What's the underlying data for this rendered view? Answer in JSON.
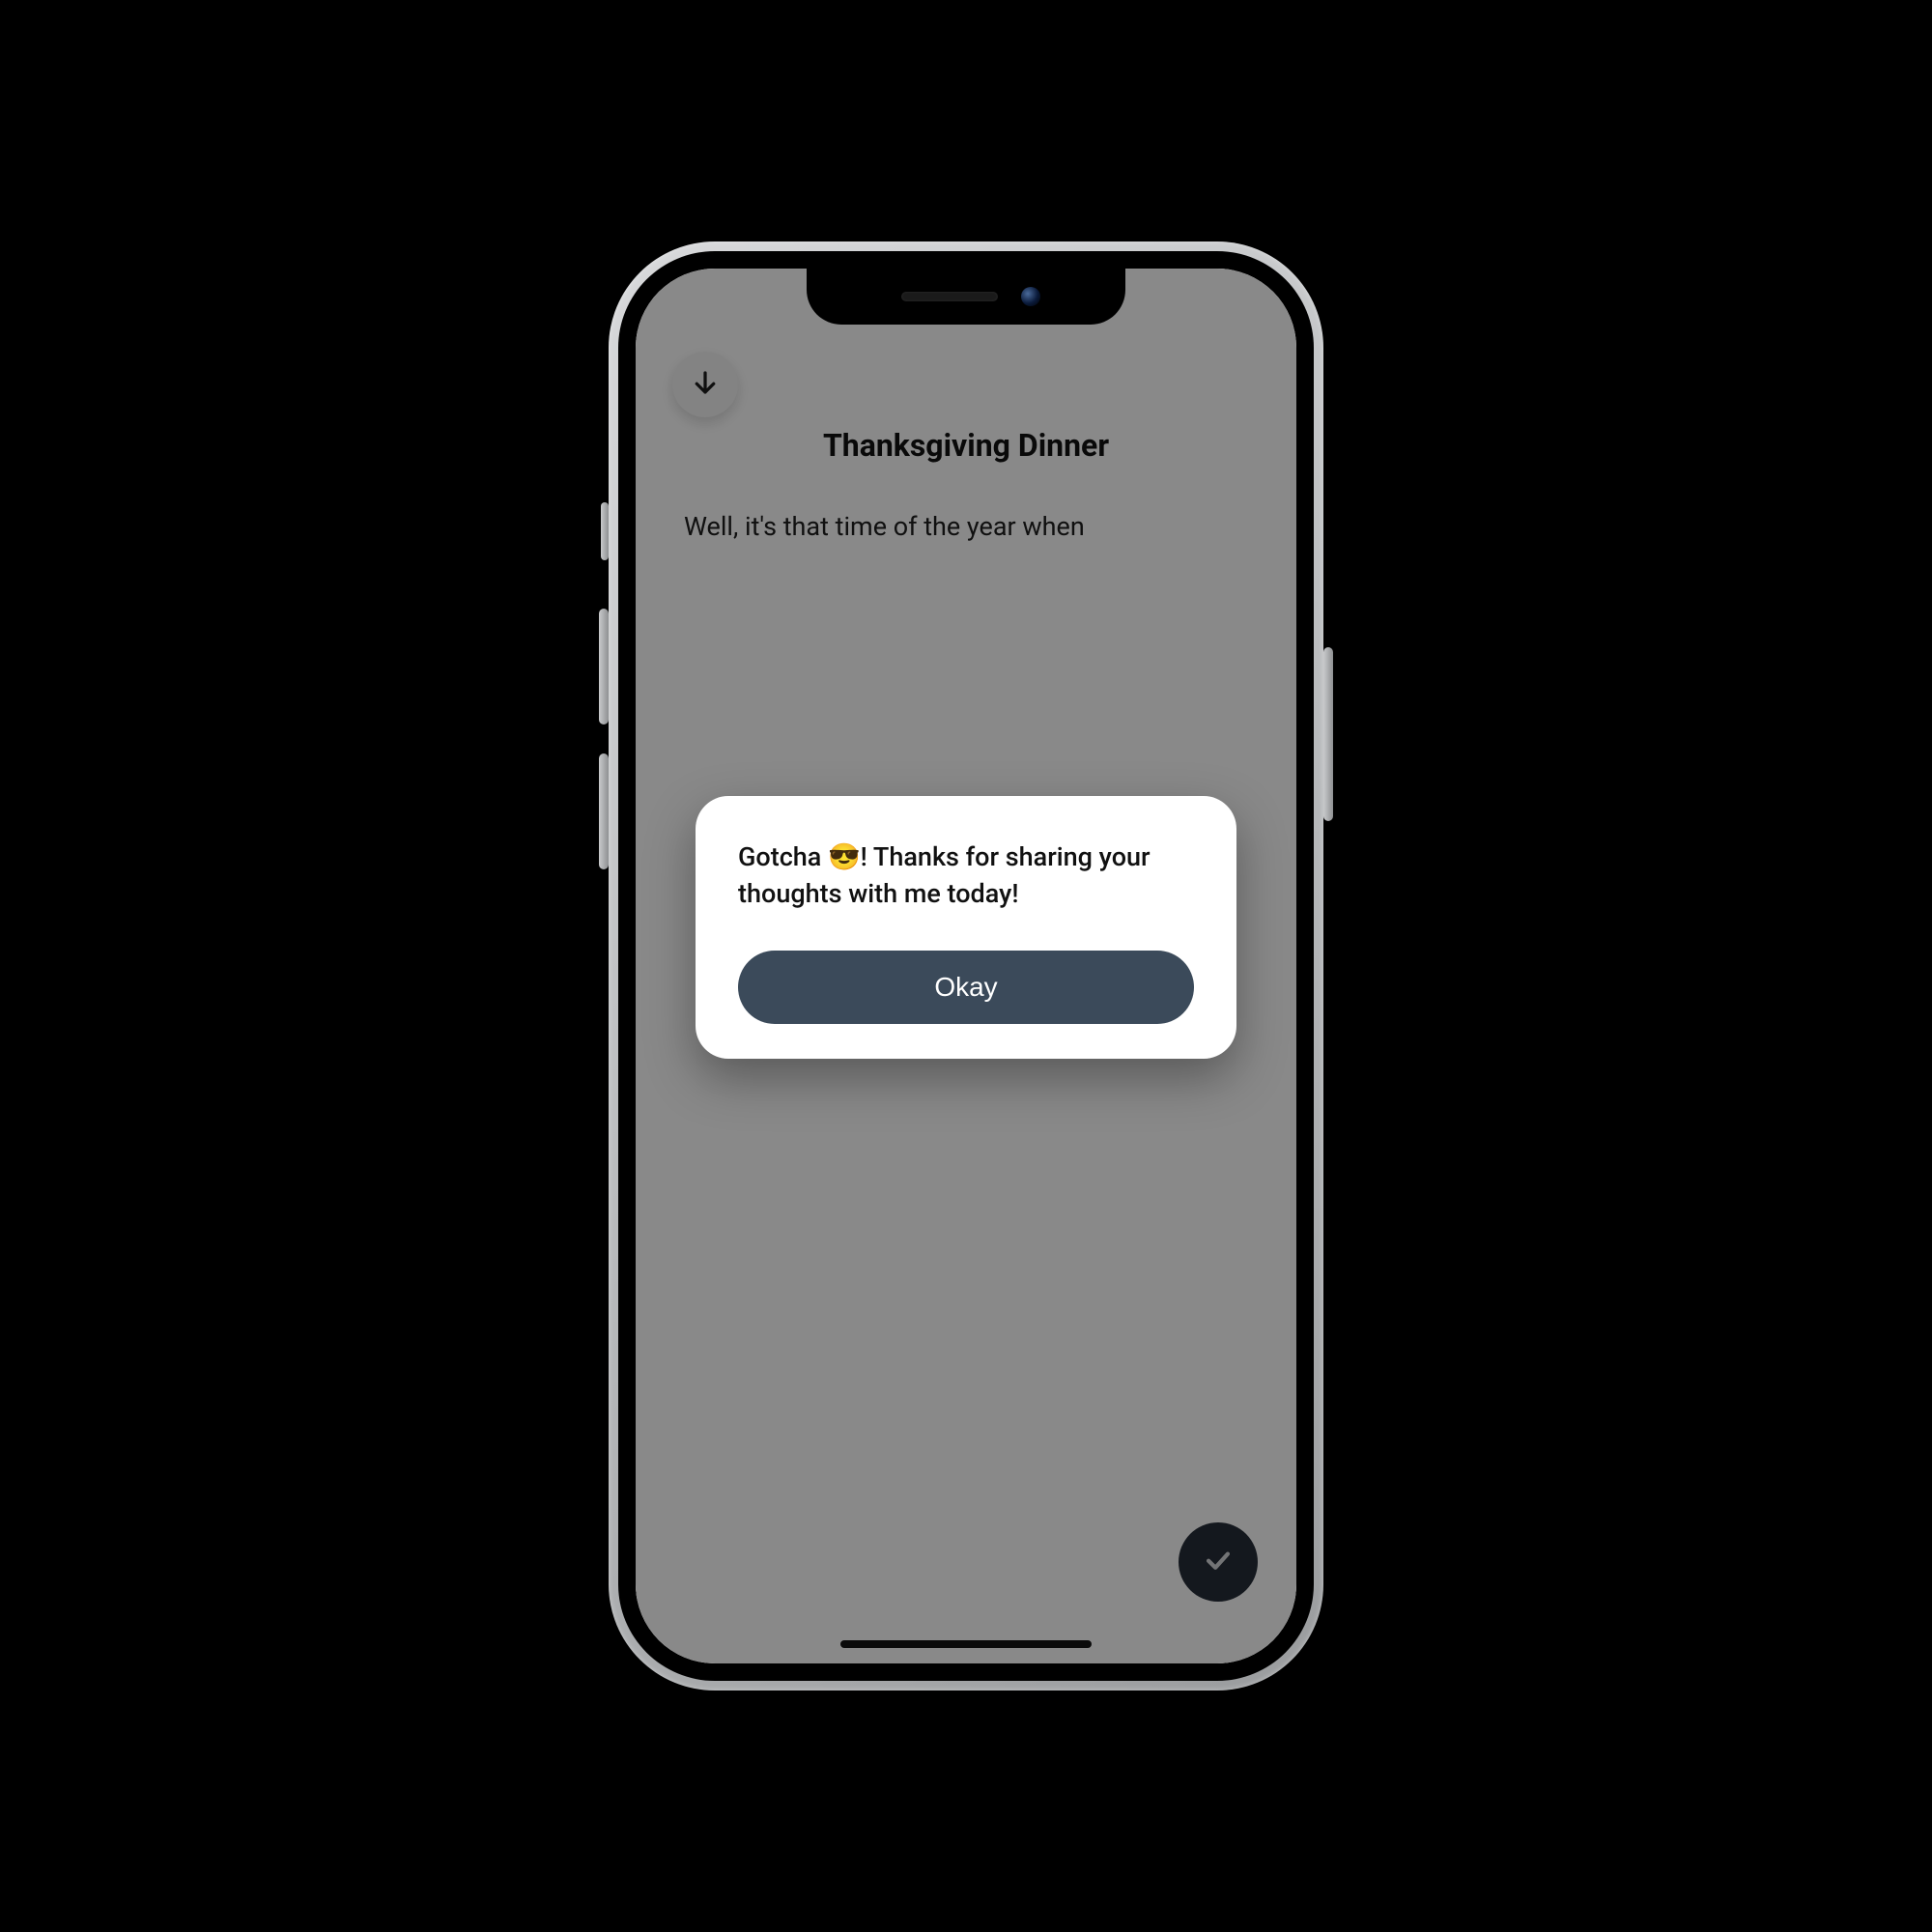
{
  "header": {
    "title": "Thanksgiving Dinner"
  },
  "back_button": {
    "icon": "arrow-down-icon"
  },
  "body": {
    "text": "Well, it's that time of the year when"
  },
  "done_button": {
    "icon": "check-icon"
  },
  "modal": {
    "message": "Gotcha 😎! Thanks for sharing your thoughts with me today!",
    "confirm_label": "Okay"
  },
  "colors": {
    "modal_button_bg": "#3b4a5a",
    "fab_bg": "#232a34",
    "overlay": "rgba(0,0,0,0.42)"
  }
}
